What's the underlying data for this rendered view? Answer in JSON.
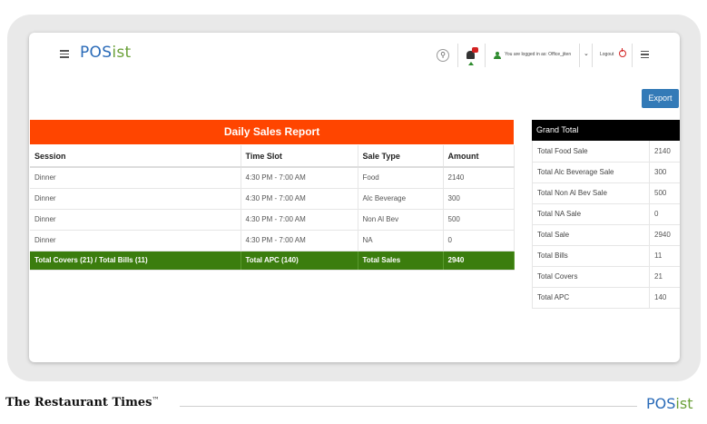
{
  "header": {
    "logo_main": "POS",
    "logo_accent": "ist",
    "logged_in_text": "You are logged in as: Office_jiten",
    "logout_label": "Logout",
    "export_label": "Export"
  },
  "report": {
    "title": "Daily Sales Report",
    "columns": [
      "Session",
      "Time Slot",
      "Sale Type",
      "Amount"
    ],
    "rows": [
      [
        "Dinner",
        "4:30 PM - 7:00 AM",
        "Food",
        "2140"
      ],
      [
        "Dinner",
        "4:30 PM - 7:00 AM",
        "Alc Beverage",
        "300"
      ],
      [
        "Dinner",
        "4:30 PM - 7:00 AM",
        "Non Al Bev",
        "500"
      ],
      [
        "Dinner",
        "4:30 PM - 7:00 AM",
        "NA",
        "0"
      ]
    ],
    "totals": [
      "Total Covers (21) / Total Bills (11)",
      "Total APC (140)",
      "Total Sales",
      "2940"
    ]
  },
  "grand_total": {
    "title": "Grand Total",
    "rows": [
      [
        "Total Food Sale",
        "2140"
      ],
      [
        "Total Alc Beverage Sale",
        "300"
      ],
      [
        "Total Non Al Bev Sale",
        "500"
      ],
      [
        "Total NA Sale",
        "0"
      ],
      [
        "Total Sale",
        "2940"
      ],
      [
        "Total Bills",
        "11"
      ],
      [
        "Total Covers",
        "21"
      ],
      [
        "Total APC",
        "140"
      ]
    ]
  },
  "footer": {
    "brand": "The Restaurant Times",
    "trademark": "™",
    "logo_main": "POS",
    "logo_accent": "ist"
  },
  "icons": [
    "hamburger-menu-icon",
    "search-icon",
    "bell-icon",
    "user-icon",
    "chevron-down-icon",
    "power-icon",
    "menu-icon"
  ],
  "colors": {
    "report_header": "#ff4500",
    "totals_row": "#3b7d0e",
    "grand_total_header": "#000000",
    "export_button": "#337ab7",
    "logo_blue": "#2a6bb8",
    "logo_green": "#6aa038"
  }
}
